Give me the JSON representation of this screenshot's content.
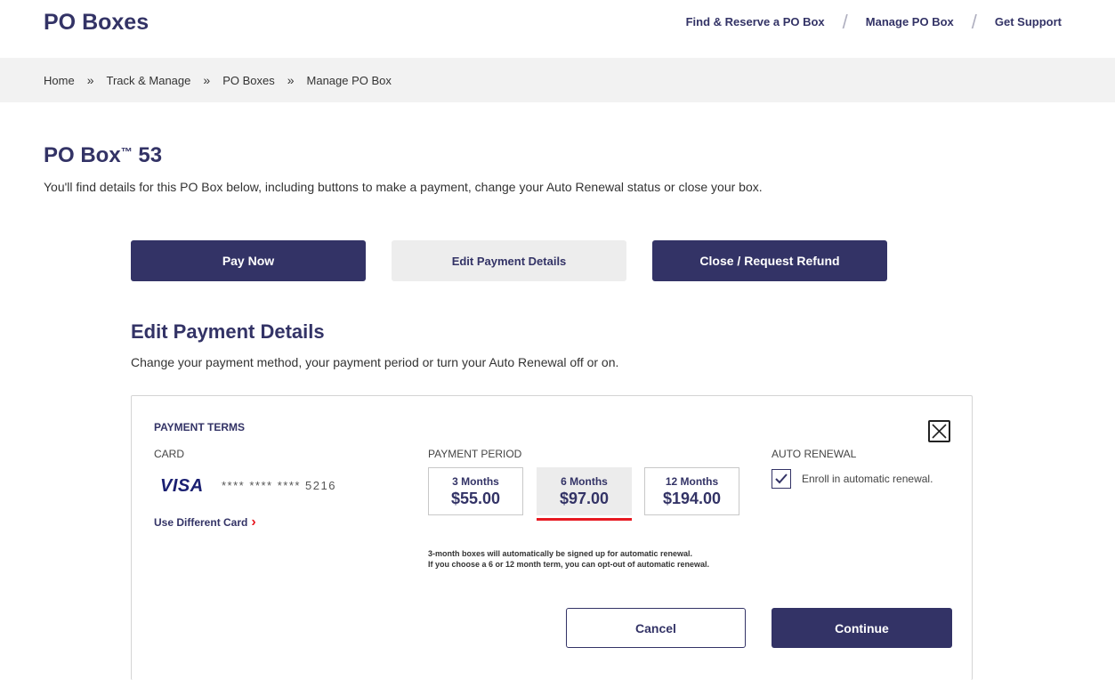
{
  "header": {
    "title": "PO Boxes",
    "nav": [
      "Find & Reserve a PO Box",
      "Manage PO Box",
      "Get Support"
    ]
  },
  "breadcrumb": [
    "Home",
    "Track & Manage",
    "PO Boxes",
    "Manage PO Box"
  ],
  "page": {
    "title_main": "PO Box",
    "title_tm": "™",
    "title_number": " 53",
    "description": "You'll find details for this PO Box below, including buttons to make a payment, change your Auto Renewal status or close your box."
  },
  "actions": {
    "pay_now": "Pay Now",
    "edit_payment": "Edit Payment Details",
    "close_refund": "Close / Request Refund"
  },
  "section": {
    "title": "Edit Payment Details",
    "description": "Change your payment method, your payment period or turn your Auto Renewal off or on."
  },
  "panel": {
    "payment_terms": "PAYMENT TERMS",
    "card_label": "CARD",
    "card_brand": "VISA",
    "card_masked": "**** **** **** 5216",
    "use_different_card": "Use Different Card",
    "payment_period_label": "PAYMENT PERIOD",
    "periods": [
      {
        "label": "3 Months",
        "price": "$55.00"
      },
      {
        "label": "6 Months",
        "price": "$97.00"
      },
      {
        "label": "12 Months",
        "price": "$194.00"
      }
    ],
    "selected_period": "6 Months",
    "note_line1": "3-month boxes will automatically be signed up for automatic renewal.",
    "note_line2": "If you choose a 6 or 12 month term, you can opt-out of automatic renewal.",
    "auto_renewal_label": "AUTO RENEWAL",
    "enroll_text": "Enroll in automatic renewal.",
    "enroll_checked": true,
    "cancel": "Cancel",
    "continue": "Continue"
  },
  "colors": {
    "brand_navy": "#333366",
    "accent_red": "#e71921",
    "visa_blue": "#1a1f71"
  },
  "icons": [
    "breadcrumb-chevron-icon",
    "close-icon",
    "checkmark-icon",
    "chevron-right-icon"
  ]
}
